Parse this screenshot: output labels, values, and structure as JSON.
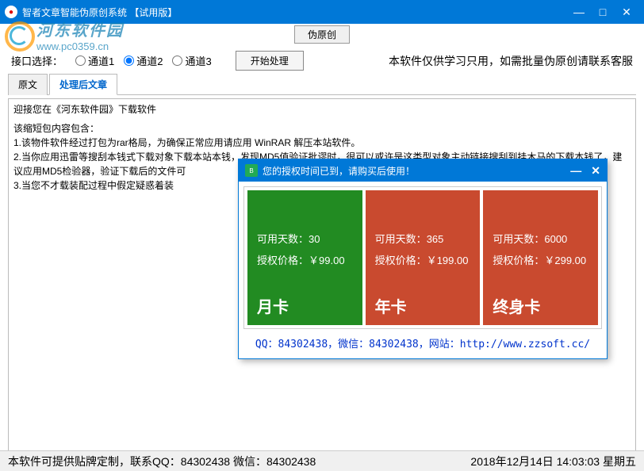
{
  "window": {
    "title": "智者文章智能伪原创系统 【试用版】"
  },
  "watermark": {
    "text_cn": "河东软件园",
    "url": "www.pc0359.cn"
  },
  "header": {
    "top_button": "伪原创",
    "interface_label": "接口选择：",
    "radios": [
      "通道1",
      "通道2",
      "通道3"
    ],
    "start_button": "开始处理",
    "notice": "本软件仅供学习只用，如需批量伪原创请联系客服"
  },
  "tabs": [
    {
      "label": "原文",
      "active": false
    },
    {
      "label": "处理后文章",
      "active": true
    }
  ],
  "content": {
    "line1": "迎接您在《河东软件园》下载软件",
    "line2": "该缩短包内容包含：",
    "line3": "1.该物件软件经过打包为rar格局，为确保正常应用请应用 WinRAR 解压本站软件。",
    "line4": "2.当你应用迅雷等搜刮本钱式下载对象下载本站本钱，发现MD5值验证批谬时，很可以或许是这类型对象主动链接搜刮到挂木马的下载本钱了，建议应用MD5检验器，验证下载后的文件可",
    "line5": "3.当您不才载装配过程中假定疑惑着装"
  },
  "dialog": {
    "title": "您的授权时间已到，请购买后使用！",
    "cards": [
      {
        "days_label": "可用天数：",
        "days": "30",
        "price_label": "授权价格：",
        "price": "￥99.00",
        "name": "月卡",
        "color": "green"
      },
      {
        "days_label": "可用天数：",
        "days": "365",
        "price_label": "授权价格：",
        "price": "￥199.00",
        "name": "年卡",
        "color": "red"
      },
      {
        "days_label": "可用天数：",
        "days": "6000",
        "price_label": "授权价格：",
        "price": "￥299.00",
        "name": "终身卡",
        "color": "red"
      }
    ],
    "footer": "QQ：84302438，微信：84302438，网站：http://www.zzsoft.cc/"
  },
  "statusbar": {
    "left": "本软件可提供贴牌定制，联系QQ：84302438 微信：84302438",
    "right": "2018年12月14日 14:03:03 星期五"
  }
}
